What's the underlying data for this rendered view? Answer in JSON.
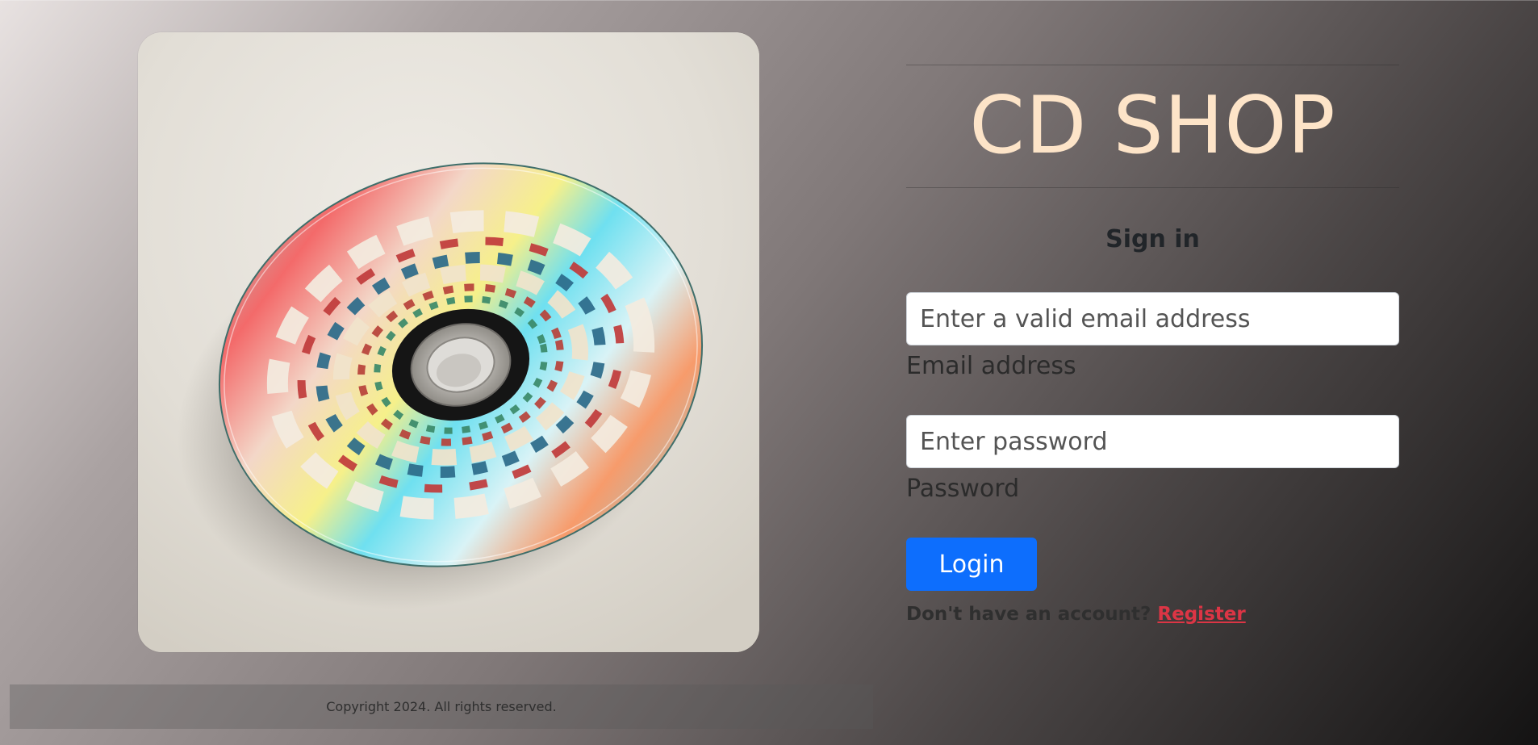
{
  "brand": {
    "title": "CD SHOP"
  },
  "hero_image": {
    "alt": "CD disc with colorful paisley artwork",
    "icon": "cd-disc-illustration"
  },
  "form": {
    "heading": "Sign in",
    "email": {
      "placeholder": "Enter a valid email address",
      "label": "Email address",
      "value": ""
    },
    "password": {
      "placeholder": "Enter password",
      "label": "Password",
      "value": ""
    },
    "login_label": "Login",
    "register_prompt": "Don't have an account?",
    "register_link": "Register"
  },
  "footer": {
    "text": "Copyright 2024. All rights reserved."
  },
  "colors": {
    "title": "#fde4c8",
    "primary_button": "#0d6efd",
    "register_link": "#dc3545"
  }
}
